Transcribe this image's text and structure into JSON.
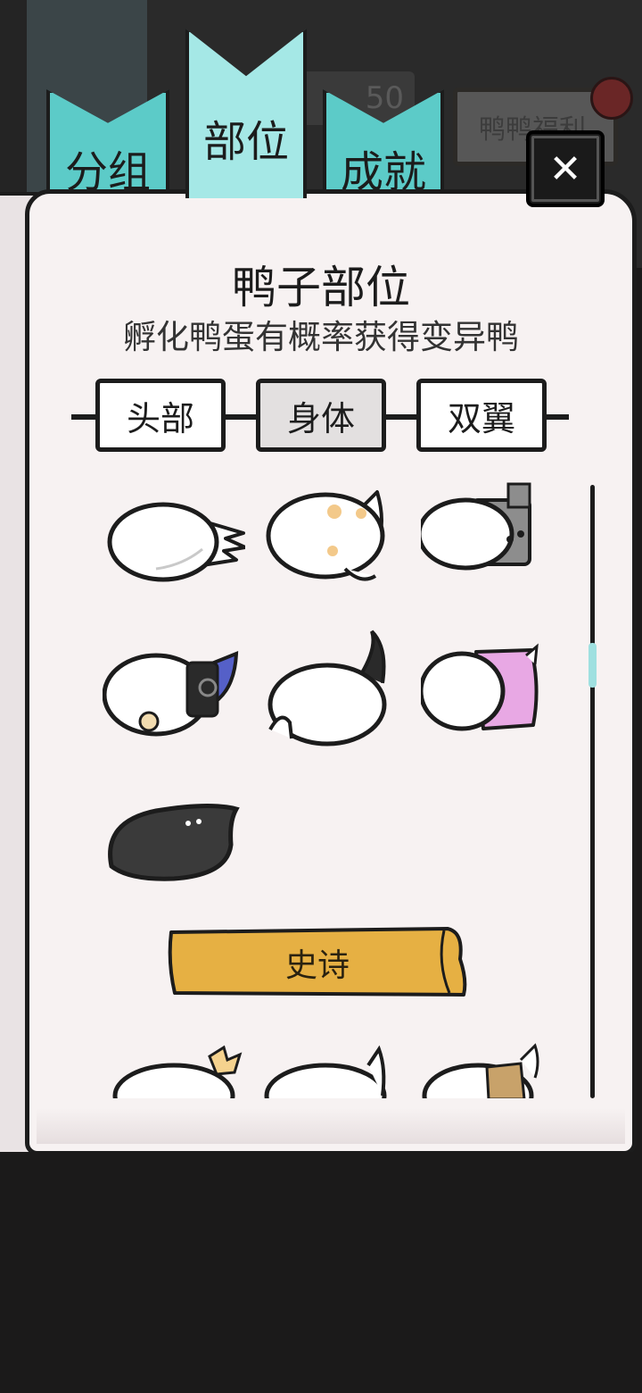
{
  "header": {
    "tabs": [
      {
        "label": "分组",
        "active": false
      },
      {
        "label": "部位",
        "active": true
      },
      {
        "label": "成就",
        "active": false
      }
    ],
    "counter_text": "50",
    "welfare_label": "鸭鸭福利",
    "close_label": "✕"
  },
  "panel": {
    "title": "鸭子部位",
    "subtitle": "孵化鸭蛋有概率获得变异鸭",
    "subtabs": [
      {
        "label": "头部",
        "active": false
      },
      {
        "label": "身体",
        "active": true
      },
      {
        "label": "双翼",
        "active": false
      }
    ],
    "items": [
      {
        "icon": "feather-tail-body-icon"
      },
      {
        "icon": "spotted-body-icon"
      },
      {
        "icon": "robot-body-icon"
      },
      {
        "icon": "armored-body-icon"
      },
      {
        "icon": "cat-tail-body-icon"
      },
      {
        "icon": "pink-body-icon"
      },
      {
        "icon": "black-body-icon"
      }
    ],
    "rarity_banner": "史诗",
    "epic_items": [
      {
        "icon": "bow-body-icon"
      },
      {
        "icon": "plain-body-icon"
      },
      {
        "icon": "patched-body-icon"
      }
    ]
  },
  "colors": {
    "tab_active": "#a5e8e6",
    "tab_inactive": "#5ccbc8",
    "banner": "#e6b043",
    "paper": "#f7f2f2"
  },
  "scroll": {
    "position": 0.3
  }
}
